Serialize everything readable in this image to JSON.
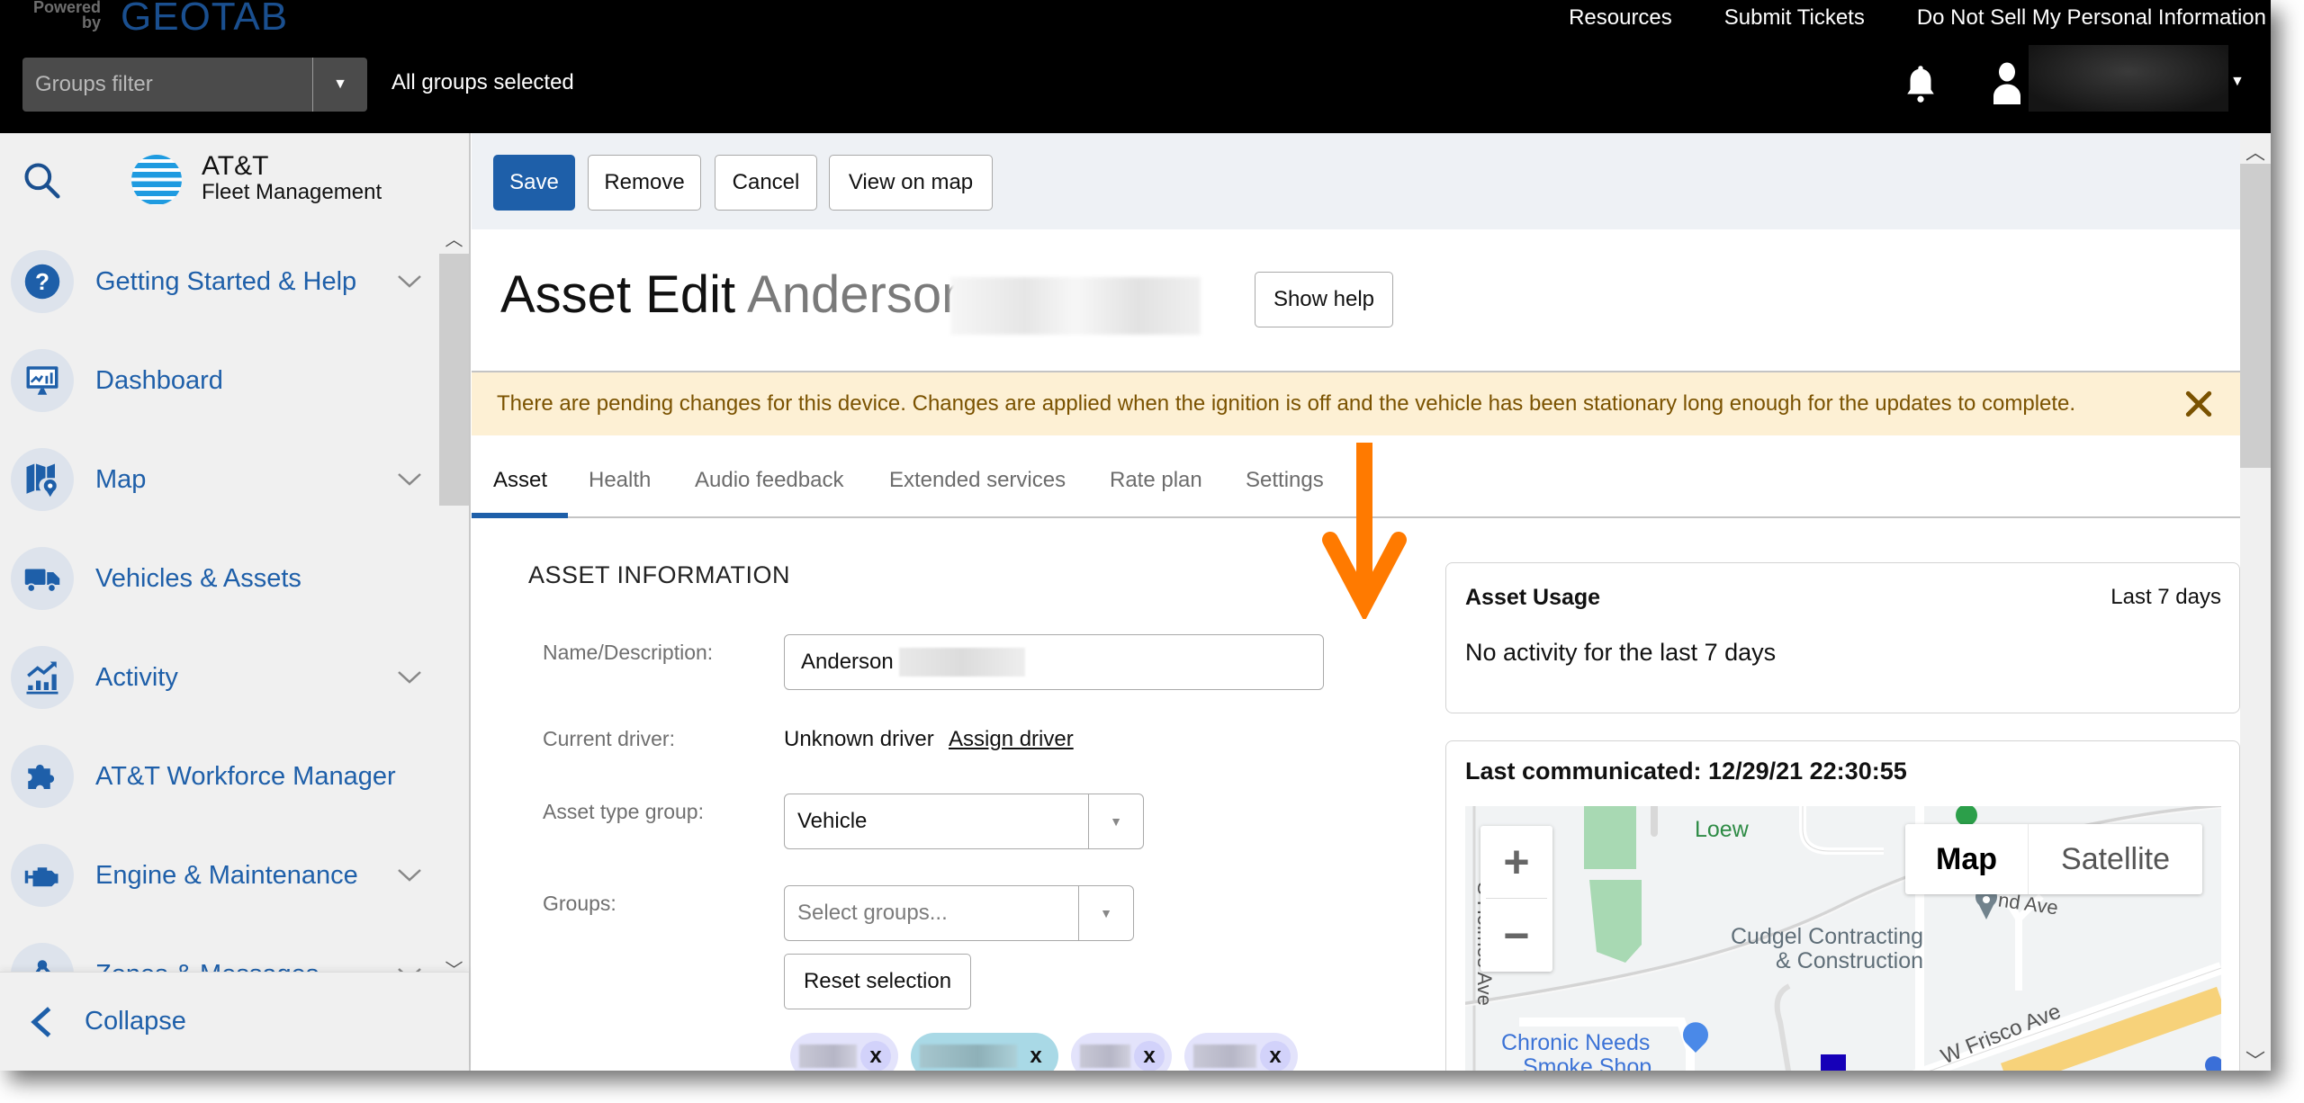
{
  "header": {
    "powered_by": "Powered by",
    "brand": "GEOTAB",
    "links": [
      "Resources",
      "Submit Tickets",
      "Do Not Sell My Personal Information"
    ],
    "groups_filter": {
      "placeholder": "Groups filter",
      "status": "All groups selected"
    },
    "user_name_redacted": true
  },
  "sidebar": {
    "brand_line1": "AT&T",
    "brand_line2": "Fleet Management",
    "items": [
      {
        "label": "Getting Started & Help",
        "icon": "help-circle-icon",
        "expandable": true
      },
      {
        "label": "Dashboard",
        "icon": "dashboard-monitor-icon",
        "expandable": false
      },
      {
        "label": "Map",
        "icon": "map-pin-icon",
        "expandable": true
      },
      {
        "label": "Vehicles & Assets",
        "icon": "truck-icon",
        "expandable": false
      },
      {
        "label": "Activity",
        "icon": "activity-chart-icon",
        "expandable": true
      },
      {
        "label": "AT&T Workforce Manager",
        "icon": "puzzle-icon",
        "expandable": false
      },
      {
        "label": "Engine & Maintenance",
        "icon": "engine-icon",
        "expandable": true
      },
      {
        "label": "Zones & Messages",
        "icon": "zones-icon",
        "expandable": true
      }
    ],
    "collapse_label": "Collapse"
  },
  "toolbar": {
    "save": "Save",
    "remove": "Remove",
    "cancel": "Cancel",
    "view_on_map": "View on map"
  },
  "page": {
    "title": "Asset Edit",
    "subtitle": "Anderson",
    "show_help": "Show help"
  },
  "banner": {
    "message": "There are pending changes for this device. Changes are applied when the ignition is off and the vehicle has been stationary long enough for the updates to complete.",
    "close": "X"
  },
  "tabs": [
    {
      "label": "Asset",
      "active": true
    },
    {
      "label": "Health",
      "active": false
    },
    {
      "label": "Audio feedback",
      "active": false
    },
    {
      "label": "Extended services",
      "active": false
    },
    {
      "label": "Rate plan",
      "active": false
    },
    {
      "label": "Settings",
      "active": false
    }
  ],
  "asset_info": {
    "section_title": "ASSET INFORMATION",
    "name_label": "Name/Description:",
    "name_value": "Anderson",
    "driver_label": "Current driver:",
    "driver_value": "Unknown driver",
    "assign_driver": "Assign driver",
    "type_label": "Asset type group:",
    "type_value": "Vehicle",
    "groups_label": "Groups:",
    "groups_placeholder": "Select groups...",
    "reset_selection": "Reset selection",
    "group_chips": [
      {
        "redacted": true,
        "remove": "x"
      },
      {
        "redacted": true,
        "remove": "x"
      },
      {
        "redacted": true,
        "remove": "x"
      },
      {
        "redacted": true,
        "remove": "x"
      }
    ]
  },
  "asset_usage": {
    "title": "Asset Usage",
    "range": "Last 7 days",
    "message": "No activity for the last 7 days"
  },
  "last_communicated": {
    "label": "Last communicated: 12/29/21 22:30:55",
    "map": {
      "zoom_in": "+",
      "zoom_out": "−",
      "type_map": "Map",
      "type_satellite": "Satellite",
      "labels": {
        "poi1": "Cudgel Contracting",
        "poi1b": "& Construction",
        "poi2": "Chronic Needs",
        "poi2b": "Smoke Shop",
        "street1": "S Holmes Ave",
        "street2": "W Frisco Ave",
        "street3": "nd Ave",
        "park": "Loew"
      }
    }
  },
  "colors": {
    "brand_blue": "#1e5fa9",
    "banner_bg": "#fdf0d4",
    "banner_text": "#7a5200",
    "annotation_arrow": "#ff7a00"
  }
}
